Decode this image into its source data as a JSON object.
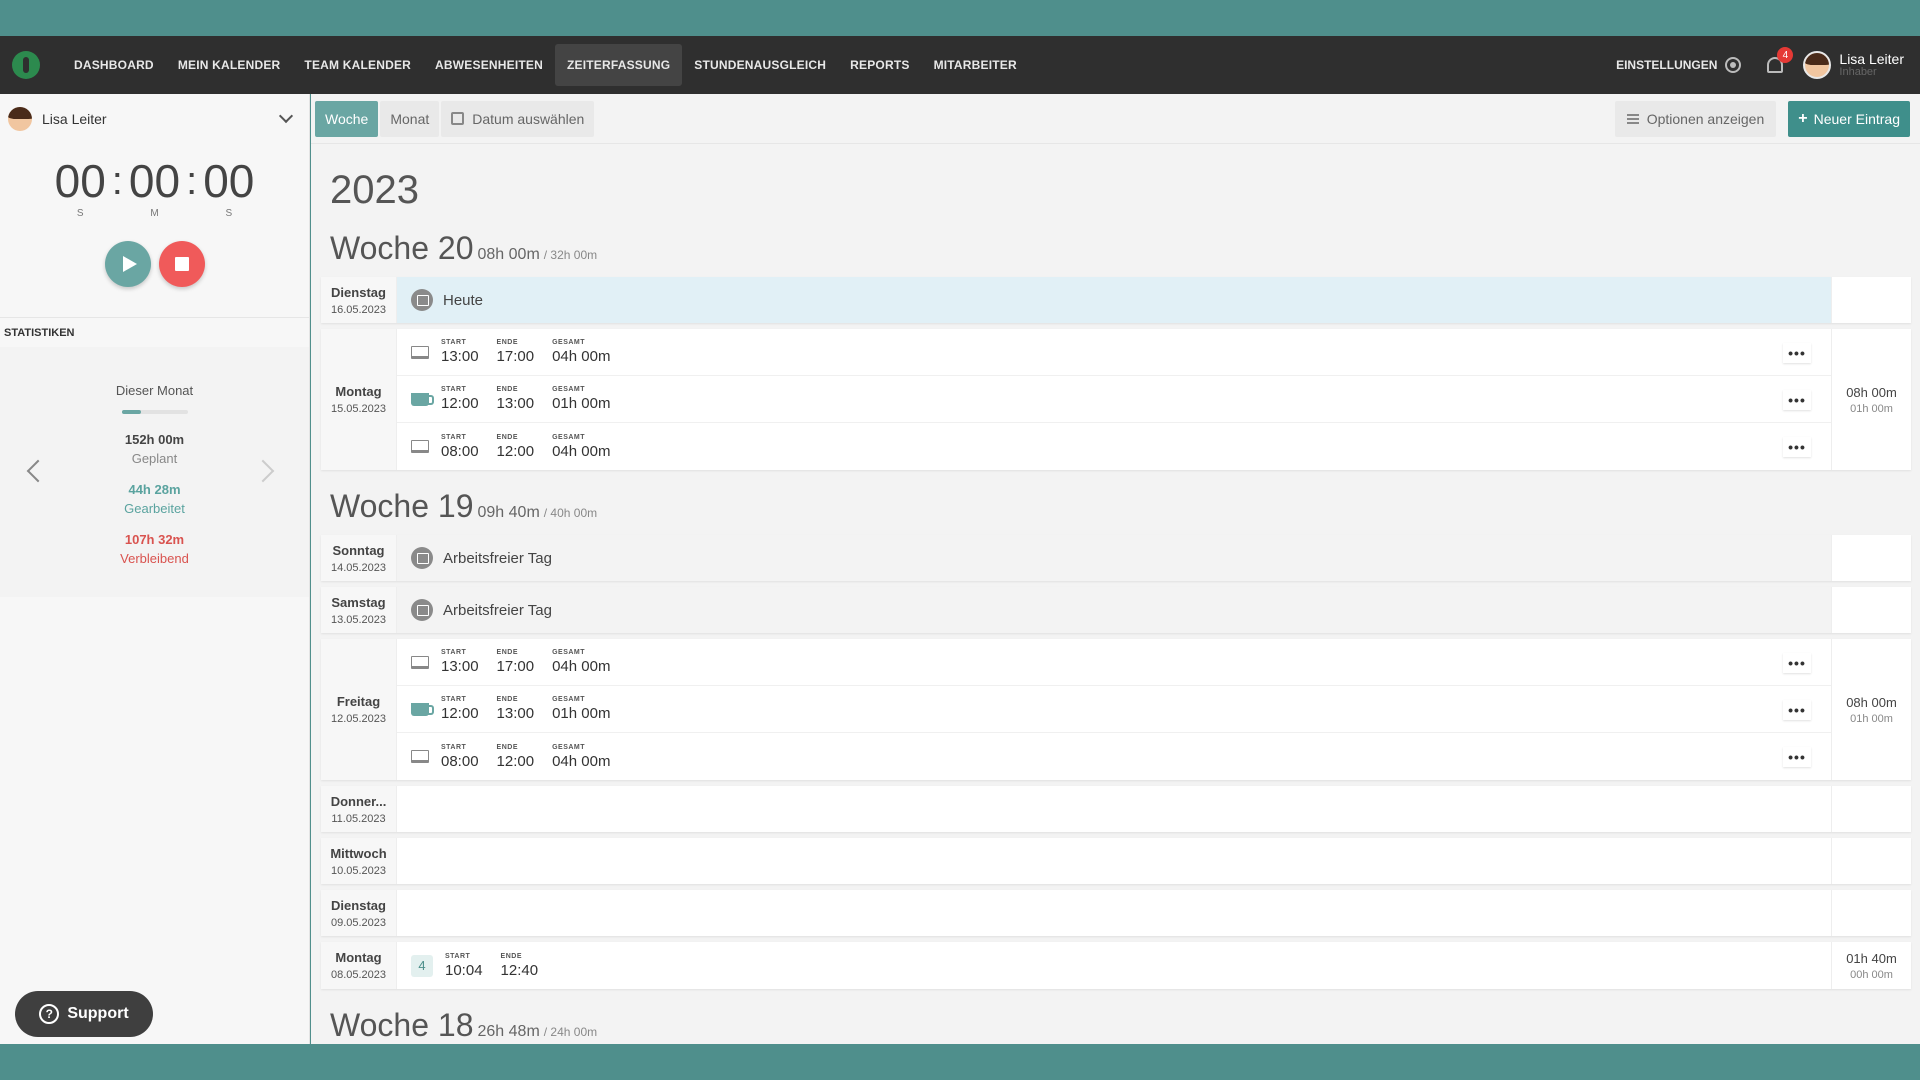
{
  "nav": {
    "items": [
      "DASHBOARD",
      "MEIN KALENDER",
      "TEAM KALENDER",
      "ABWESENHEITEN",
      "ZEITERFASSUNG",
      "STUNDENAUSGLEICH",
      "REPORTS",
      "MITARBEITER"
    ],
    "active_index": 4,
    "settings_label": "EINSTELLUNGEN",
    "notification_count": "4",
    "user_name": "Lisa Leiter",
    "user_role": "Inhaber"
  },
  "sidebar": {
    "user_name": "Lisa Leiter",
    "timer": {
      "h": "00",
      "m": "00",
      "s": "00",
      "h_label": "S",
      "m_label": "M",
      "s_label": "S"
    },
    "stats_title": "STATISTIKEN",
    "stats": {
      "month_label": "Dieser Monat",
      "progress": 0.29,
      "planned_value": "152h 00m",
      "planned_label": "Geplant",
      "worked_value": "44h 28m",
      "worked_label": "Gearbeitet",
      "remaining_value": "107h 32m",
      "remaining_label": "Verbleibend"
    },
    "support_label": "Support"
  },
  "toolbar": {
    "week_label": "Woche",
    "month_label": "Monat",
    "date_label": "Datum auswählen",
    "options_label": "Optionen anzeigen",
    "new_label": "Neuer Eintrag"
  },
  "labels": {
    "start": "START",
    "end": "ENDE",
    "total": "GESAMT"
  },
  "year": "2023",
  "weeks": [
    {
      "title": "Woche 20",
      "total": "08h 00m",
      "planned": "/ 32h 00m",
      "days": [
        {
          "name": "Dienstag",
          "date": "16.05.2023",
          "type": "today",
          "label": "Heute"
        },
        {
          "name": "Montag",
          "date": "15.05.2023",
          "type": "entries",
          "total": "08h 00m",
          "break": "01h 00m",
          "entries": [
            {
              "icon": "laptop",
              "start": "13:00",
              "end": "17:00",
              "total": "04h 00m"
            },
            {
              "icon": "coffee",
              "start": "12:00",
              "end": "13:00",
              "total": "01h 00m"
            },
            {
              "icon": "laptop",
              "start": "08:00",
              "end": "12:00",
              "total": "04h 00m"
            }
          ]
        }
      ]
    },
    {
      "title": "Woche 19",
      "total": "09h 40m",
      "planned": "/ 40h 00m",
      "days": [
        {
          "name": "Sonntag",
          "date": "14.05.2023",
          "type": "off",
          "label": "Arbeitsfreier Tag"
        },
        {
          "name": "Samstag",
          "date": "13.05.2023",
          "type": "off",
          "label": "Arbeitsfreier Tag"
        },
        {
          "name": "Freitag",
          "date": "12.05.2023",
          "type": "entries",
          "total": "08h 00m",
          "break": "01h 00m",
          "entries": [
            {
              "icon": "laptop",
              "start": "13:00",
              "end": "17:00",
              "total": "04h 00m"
            },
            {
              "icon": "coffee",
              "start": "12:00",
              "end": "13:00",
              "total": "01h 00m"
            },
            {
              "icon": "laptop",
              "start": "08:00",
              "end": "12:00",
              "total": "04h 00m"
            }
          ]
        },
        {
          "name": "Donner...",
          "date": "11.05.2023",
          "type": "empty"
        },
        {
          "name": "Mittwoch",
          "date": "10.05.2023",
          "type": "empty"
        },
        {
          "name": "Dienstag",
          "date": "09.05.2023",
          "type": "empty"
        },
        {
          "name": "Montag",
          "date": "08.05.2023",
          "type": "running",
          "total": "01h 40m",
          "break": "00h 00m",
          "entries": [
            {
              "icon": "num",
              "num": "4",
              "start": "10:04",
              "end": "12:40"
            }
          ]
        }
      ]
    },
    {
      "title": "Woche 18",
      "total": "26h 48m",
      "planned": "/ 24h 00m",
      "days": []
    }
  ],
  "icons": [
    "logo-icon",
    "gear-icon",
    "bell-icon",
    "chevron-down-icon",
    "play-icon",
    "stop-icon",
    "calendar-icon",
    "sliders-icon",
    "plus-icon",
    "laptop-icon",
    "coffee-icon",
    "more-icon",
    "question-icon"
  ]
}
